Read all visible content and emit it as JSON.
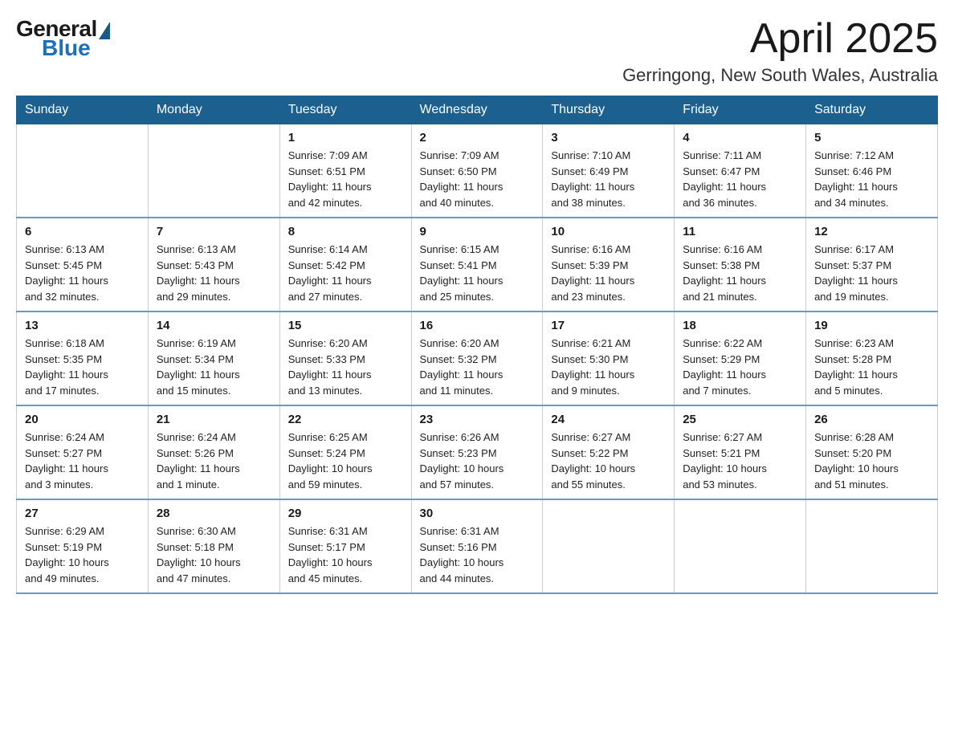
{
  "logo": {
    "general": "General",
    "blue": "Blue"
  },
  "header": {
    "month": "April 2025",
    "location": "Gerringong, New South Wales, Australia"
  },
  "weekdays": [
    "Sunday",
    "Monday",
    "Tuesday",
    "Wednesday",
    "Thursday",
    "Friday",
    "Saturday"
  ],
  "weeks": [
    [
      {
        "day": "",
        "info": ""
      },
      {
        "day": "",
        "info": ""
      },
      {
        "day": "1",
        "info": "Sunrise: 7:09 AM\nSunset: 6:51 PM\nDaylight: 11 hours\nand 42 minutes."
      },
      {
        "day": "2",
        "info": "Sunrise: 7:09 AM\nSunset: 6:50 PM\nDaylight: 11 hours\nand 40 minutes."
      },
      {
        "day": "3",
        "info": "Sunrise: 7:10 AM\nSunset: 6:49 PM\nDaylight: 11 hours\nand 38 minutes."
      },
      {
        "day": "4",
        "info": "Sunrise: 7:11 AM\nSunset: 6:47 PM\nDaylight: 11 hours\nand 36 minutes."
      },
      {
        "day": "5",
        "info": "Sunrise: 7:12 AM\nSunset: 6:46 PM\nDaylight: 11 hours\nand 34 minutes."
      }
    ],
    [
      {
        "day": "6",
        "info": "Sunrise: 6:13 AM\nSunset: 5:45 PM\nDaylight: 11 hours\nand 32 minutes."
      },
      {
        "day": "7",
        "info": "Sunrise: 6:13 AM\nSunset: 5:43 PM\nDaylight: 11 hours\nand 29 minutes."
      },
      {
        "day": "8",
        "info": "Sunrise: 6:14 AM\nSunset: 5:42 PM\nDaylight: 11 hours\nand 27 minutes."
      },
      {
        "day": "9",
        "info": "Sunrise: 6:15 AM\nSunset: 5:41 PM\nDaylight: 11 hours\nand 25 minutes."
      },
      {
        "day": "10",
        "info": "Sunrise: 6:16 AM\nSunset: 5:39 PM\nDaylight: 11 hours\nand 23 minutes."
      },
      {
        "day": "11",
        "info": "Sunrise: 6:16 AM\nSunset: 5:38 PM\nDaylight: 11 hours\nand 21 minutes."
      },
      {
        "day": "12",
        "info": "Sunrise: 6:17 AM\nSunset: 5:37 PM\nDaylight: 11 hours\nand 19 minutes."
      }
    ],
    [
      {
        "day": "13",
        "info": "Sunrise: 6:18 AM\nSunset: 5:35 PM\nDaylight: 11 hours\nand 17 minutes."
      },
      {
        "day": "14",
        "info": "Sunrise: 6:19 AM\nSunset: 5:34 PM\nDaylight: 11 hours\nand 15 minutes."
      },
      {
        "day": "15",
        "info": "Sunrise: 6:20 AM\nSunset: 5:33 PM\nDaylight: 11 hours\nand 13 minutes."
      },
      {
        "day": "16",
        "info": "Sunrise: 6:20 AM\nSunset: 5:32 PM\nDaylight: 11 hours\nand 11 minutes."
      },
      {
        "day": "17",
        "info": "Sunrise: 6:21 AM\nSunset: 5:30 PM\nDaylight: 11 hours\nand 9 minutes."
      },
      {
        "day": "18",
        "info": "Sunrise: 6:22 AM\nSunset: 5:29 PM\nDaylight: 11 hours\nand 7 minutes."
      },
      {
        "day": "19",
        "info": "Sunrise: 6:23 AM\nSunset: 5:28 PM\nDaylight: 11 hours\nand 5 minutes."
      }
    ],
    [
      {
        "day": "20",
        "info": "Sunrise: 6:24 AM\nSunset: 5:27 PM\nDaylight: 11 hours\nand 3 minutes."
      },
      {
        "day": "21",
        "info": "Sunrise: 6:24 AM\nSunset: 5:26 PM\nDaylight: 11 hours\nand 1 minute."
      },
      {
        "day": "22",
        "info": "Sunrise: 6:25 AM\nSunset: 5:24 PM\nDaylight: 10 hours\nand 59 minutes."
      },
      {
        "day": "23",
        "info": "Sunrise: 6:26 AM\nSunset: 5:23 PM\nDaylight: 10 hours\nand 57 minutes."
      },
      {
        "day": "24",
        "info": "Sunrise: 6:27 AM\nSunset: 5:22 PM\nDaylight: 10 hours\nand 55 minutes."
      },
      {
        "day": "25",
        "info": "Sunrise: 6:27 AM\nSunset: 5:21 PM\nDaylight: 10 hours\nand 53 minutes."
      },
      {
        "day": "26",
        "info": "Sunrise: 6:28 AM\nSunset: 5:20 PM\nDaylight: 10 hours\nand 51 minutes."
      }
    ],
    [
      {
        "day": "27",
        "info": "Sunrise: 6:29 AM\nSunset: 5:19 PM\nDaylight: 10 hours\nand 49 minutes."
      },
      {
        "day": "28",
        "info": "Sunrise: 6:30 AM\nSunset: 5:18 PM\nDaylight: 10 hours\nand 47 minutes."
      },
      {
        "day": "29",
        "info": "Sunrise: 6:31 AM\nSunset: 5:17 PM\nDaylight: 10 hours\nand 45 minutes."
      },
      {
        "day": "30",
        "info": "Sunrise: 6:31 AM\nSunset: 5:16 PM\nDaylight: 10 hours\nand 44 minutes."
      },
      {
        "day": "",
        "info": ""
      },
      {
        "day": "",
        "info": ""
      },
      {
        "day": "",
        "info": ""
      }
    ]
  ],
  "colors": {
    "header_bg": "#1c6090",
    "header_text": "#ffffff",
    "border": "#ccc",
    "row_border": "#6699cc"
  }
}
